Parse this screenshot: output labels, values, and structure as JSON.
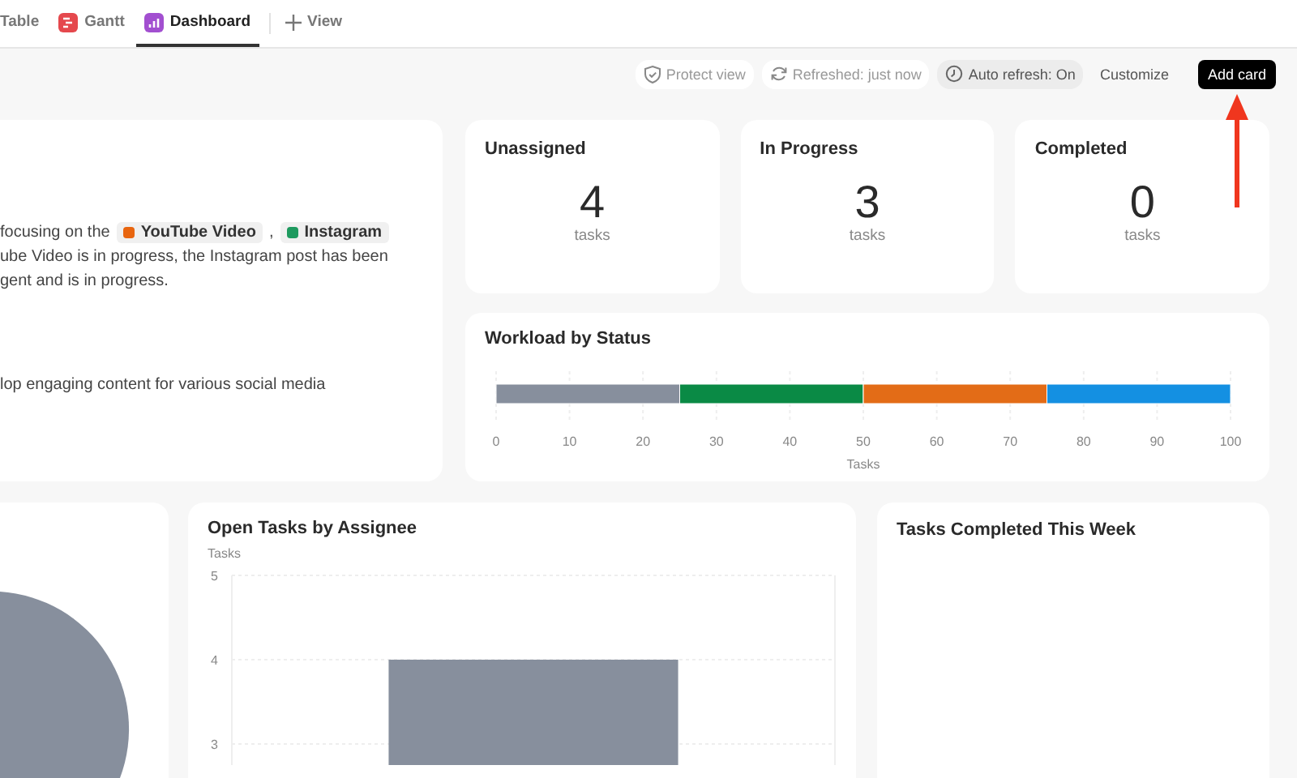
{
  "tabs": [
    {
      "label": "Table",
      "selected": false
    },
    {
      "label": "Gantt",
      "selected": false
    },
    {
      "label": "Dashboard",
      "selected": true
    }
  ],
  "add_view": {
    "label": "View"
  },
  "toolbar": [
    {
      "kind": "protect",
      "label": "Protect view",
      "on": false
    },
    {
      "kind": "refresh",
      "label": "Refreshed: just now",
      "on": false
    },
    {
      "kind": "clock",
      "label": "Auto refresh: On",
      "on": true
    },
    {
      "kind": "plain",
      "label": "Customize",
      "on": false
    },
    {
      "kind": "primary",
      "label": "Add card",
      "on": false
    }
  ],
  "annotation": {
    "kind": "arrow"
  },
  "summary": {
    "lines": [
      {
        "segments": [
          {
            "kind": "text",
            "text": "focusing on the"
          },
          {
            "kind": "chip",
            "text": "YouTube Video",
            "color": "#e8650f"
          },
          {
            "kind": "text",
            "text": ","
          },
          {
            "kind": "chip",
            "text": "Instagram",
            "color": "#1e9a5f"
          }
        ]
      },
      {
        "segments": [
          {
            "kind": "text",
            "text": "ube Video is in progress, the Instagram post has been"
          }
        ]
      },
      {
        "segments": [
          {
            "kind": "text",
            "text": "gent and is in progress."
          }
        ]
      },
      {
        "segments": [
          {
            "kind": "gap"
          }
        ]
      },
      {
        "segments": [
          {
            "kind": "text",
            "text": "lop engaging content for various social media"
          }
        ]
      }
    ]
  },
  "stats": [
    {
      "title": "Unassigned",
      "value": "4",
      "unit": "tasks"
    },
    {
      "title": "In Progress",
      "value": "3",
      "unit": "tasks"
    },
    {
      "title": "Completed",
      "value": "0",
      "unit": "tasks"
    }
  ],
  "workload": {
    "title": "Workload by Status",
    "chart_data": {
      "type": "bar",
      "orientation": "horizontal",
      "stacked": true,
      "xlabel": "Tasks",
      "xlim": [
        0,
        100
      ],
      "xticks": [
        0,
        10,
        20,
        30,
        40,
        50,
        60,
        70,
        80,
        90,
        100
      ],
      "grid": true,
      "categories": [
        null
      ],
      "series": [
        {
          "color": "#878f9d",
          "values": [
            25
          ]
        },
        {
          "color": "#0a8a45",
          "values": [
            25
          ]
        },
        {
          "color": "#e36c17",
          "values": [
            25
          ]
        },
        {
          "color": "#1490e2",
          "values": [
            25
          ]
        }
      ]
    }
  },
  "open_tasks": {
    "title": "Open Tasks by Assignee",
    "chart_data": {
      "type": "bar",
      "ylabel": "Tasks",
      "ylim": [
        2.75,
        5
      ],
      "yticks": [
        3,
        4,
        5
      ],
      "grid": true,
      "categories": [
        null
      ],
      "series": [
        {
          "color": "#878f9d",
          "values": [
            4
          ]
        }
      ]
    }
  },
  "completed_week": {
    "title": "Tasks Completed This Week"
  }
}
